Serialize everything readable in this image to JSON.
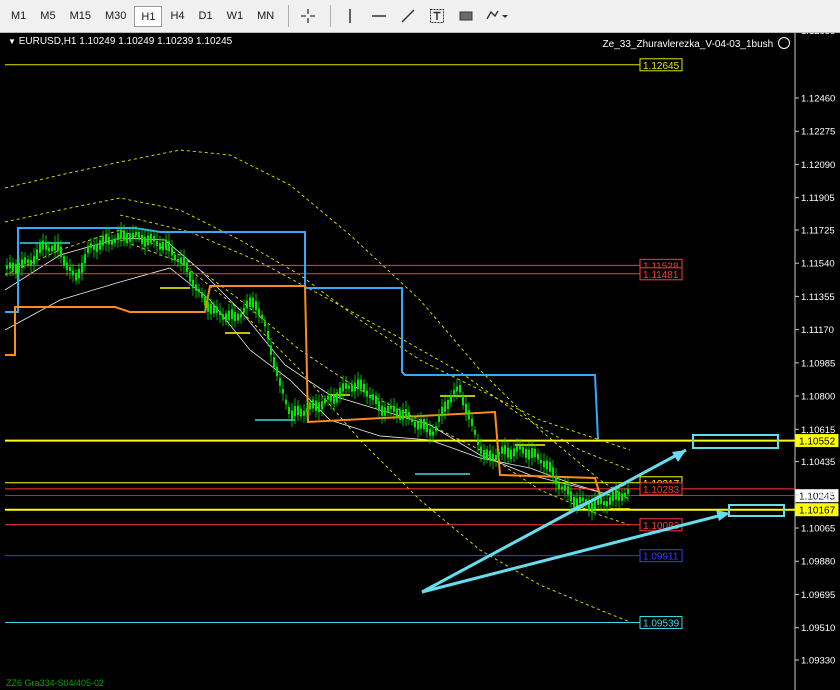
{
  "toolbar": {
    "timeframes": [
      "M1",
      "M5",
      "M15",
      "M30",
      "H1",
      "H4",
      "D1",
      "W1",
      "MN"
    ],
    "active_timeframe": "H1",
    "tools": [
      "crosshair-icon",
      "vertical-line-icon",
      "horizontal-line-icon",
      "trendline-icon",
      "text-icon",
      "rectangle-icon",
      "shapes-dropdown-icon"
    ]
  },
  "chart": {
    "title": "EURUSD,H1  1.10249 1.10249 1.10239 1.10245",
    "indicator": "Ze_33_Zhuravlerezka_V-04-03_1bush",
    "footer": "ZZ6 Gra334-S04/405-02",
    "price_axis": [
      "1.12835",
      "1.12460",
      "1.12275",
      "1.12090",
      "1.11905",
      "1.11725",
      "1.11540",
      "1.11355",
      "1.11170",
      "1.10985",
      "1.10800",
      "1.10615",
      "1.10435",
      "1.10250",
      "1.10065",
      "1.09880",
      "1.09695",
      "1.09510",
      "1.09330"
    ],
    "current_price": "1.10245",
    "levels": [
      {
        "price": "1.12645",
        "color": "#e6e600"
      },
      {
        "price": "1.11528",
        "color": "#ff3a3a"
      },
      {
        "price": "1.11481",
        "color": "#ff3a3a"
      },
      {
        "price": "1.10552",
        "color": "#ffff00"
      },
      {
        "price": "1.10317",
        "color": "#ffff00"
      },
      {
        "price": "1.10283",
        "color": "#ff3a3a"
      },
      {
        "price": "1.10167",
        "color": "#ffff00"
      },
      {
        "price": "1.10083",
        "color": "#ff3a3a"
      },
      {
        "price": "1.09911",
        "color": "#3a3aff"
      },
      {
        "price": "1.09539",
        "color": "#40d8e8"
      }
    ],
    "colors": {
      "candles": "#00e600",
      "blue_channel": "#33aaff",
      "orange_channel": "#ff8c1a",
      "arrows": "#66ddee"
    }
  }
}
